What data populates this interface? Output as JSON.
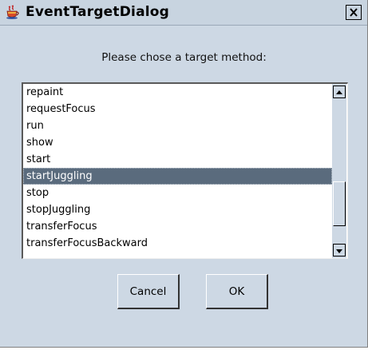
{
  "window": {
    "title": "EventTargetDialog",
    "icon": "java-coffee-cup-icon",
    "close_icon": "close-icon"
  },
  "prompt": "Please chose a target method:",
  "methods": [
    {
      "label": "repaint",
      "selected": false
    },
    {
      "label": "requestFocus",
      "selected": false
    },
    {
      "label": "run",
      "selected": false
    },
    {
      "label": "show",
      "selected": false
    },
    {
      "label": "start",
      "selected": false
    },
    {
      "label": "startJuggling",
      "selected": true
    },
    {
      "label": "stop",
      "selected": false
    },
    {
      "label": "stopJuggling",
      "selected": false
    },
    {
      "label": "transferFocus",
      "selected": false
    },
    {
      "label": "transferFocusBackward",
      "selected": false
    }
  ],
  "buttons": {
    "cancel": "Cancel",
    "ok": "OK"
  },
  "colors": {
    "background": "#cdd8e4",
    "selection": "#5a6b7d"
  }
}
